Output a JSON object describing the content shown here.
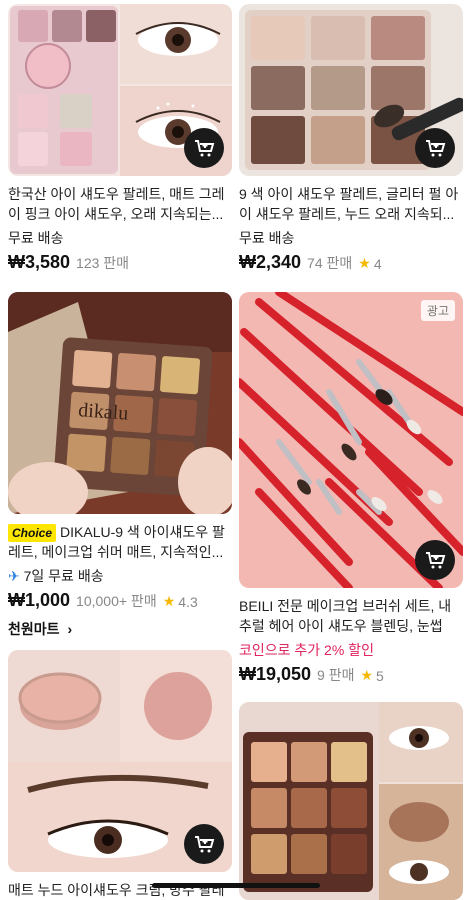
{
  "products": {
    "p1": {
      "title": "한국산 아이 섀도우 팔레트, 매트 그레이 핑크 아이 섀도우, 오래 지속되는...",
      "shipping": "무료 배송",
      "price": "₩3,580",
      "sold": "123 판매"
    },
    "p2": {
      "title": "9 색 아이 섀도우 팔레트, 글리터 펄 아이 섀도우 팔레트, 누드 오래 지속되...",
      "shipping": "무료 배송",
      "price": "₩2,340",
      "sold": "74 판매",
      "rating": "4"
    },
    "p3": {
      "badge": "Choice",
      "title": "DIKALU-9 색 아이섀도우 팔레트, 메이크업 쉬머 매트, 지속적인...",
      "shipping_days": "7일 무료 배송",
      "price": "₩1,000",
      "sold": "10,000+ 판매",
      "rating": "4.3",
      "store": "천원마트",
      "palette_text": "dikalu"
    },
    "p4": {
      "ad_label": "광고",
      "title": "BEILI 전문 메이크업 브러쉬 세트, 내추럴 헤어 아이 섀도우 블렌딩, 눈썹 포...",
      "promo": "코인으로 추가 2% 할인",
      "price": "₩19,050",
      "sold": "9 판매",
      "rating": "5"
    },
    "p5": {
      "title": "매트 누드 아이섀도우 크림, 방수 팔레트"
    },
    "p6": {}
  },
  "colors": {
    "accent_pink": "#e0245e",
    "star": "#f5b800",
    "choice_badge": "#ffe600",
    "cart_button": "#1a1a1a"
  },
  "icons": [
    "cart-add-icon",
    "star-icon",
    "plane-icon",
    "chevron-right-icon"
  ]
}
